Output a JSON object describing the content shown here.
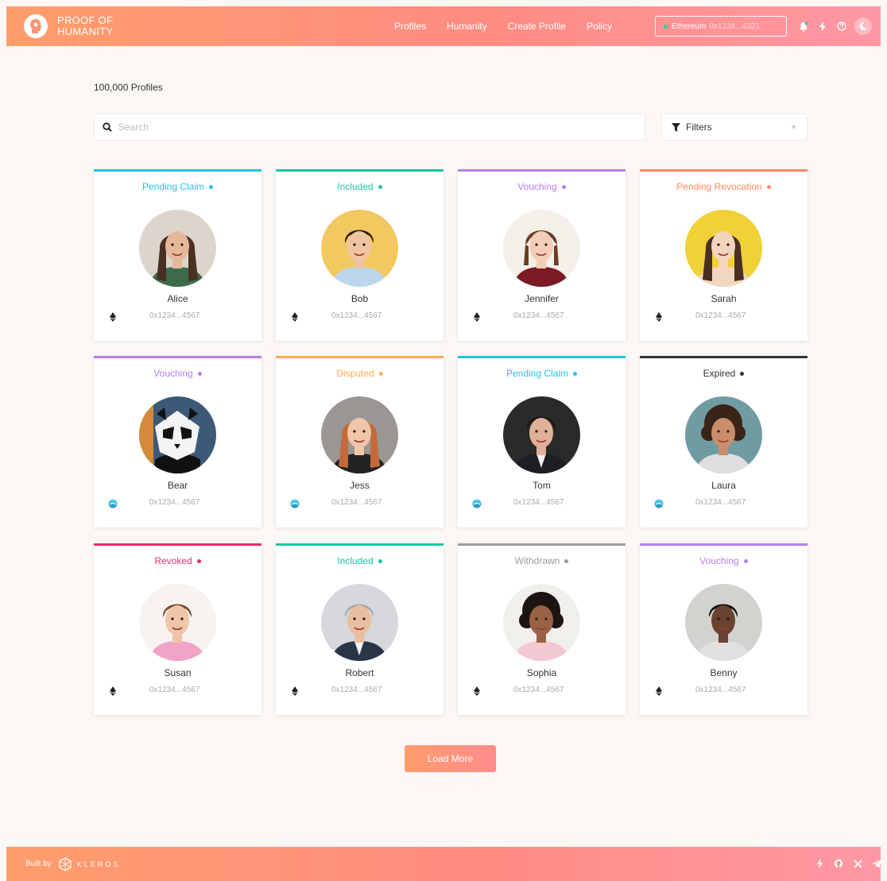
{
  "header": {
    "brand": {
      "line1": "PROOF OF",
      "line2": "HUMANITY"
    },
    "nav": [
      "Profiles",
      "Humanity",
      "Create Profile",
      "Policy"
    ],
    "wallet": {
      "network": "Ethereum",
      "address": "0x1234...4321"
    },
    "icons": [
      "bell-icon",
      "lightning-icon",
      "help-icon",
      "moon-icon"
    ]
  },
  "summary": {
    "count": "100,000",
    "label": "Profiles"
  },
  "search": {
    "placeholder": "Search"
  },
  "filters": {
    "label": "Filters"
  },
  "colors": {
    "pending_claim": "#22c4e8",
    "included": "#18c7a4",
    "vouching": "#b77ef0",
    "pending_revocation": "#ff8c5c",
    "disputed": "#ffac55",
    "expired": "#333333",
    "revoked": "#e6306d",
    "withdrawn": "#9b9b9b"
  },
  "profiles": [
    {
      "status": "Pending Claim",
      "status_key": "pending_claim",
      "name": "Alice",
      "chain": "ethereum",
      "address": "0x1234...4567"
    },
    {
      "status": "Included",
      "status_key": "included",
      "name": "Bob",
      "chain": "ethereum",
      "address": "0x1234...4567"
    },
    {
      "status": "Vouching",
      "status_key": "vouching",
      "name": "Jennifer",
      "chain": "ethereum",
      "address": "0x1234...4567"
    },
    {
      "status": "Pending Revocation",
      "status_key": "pending_revocation",
      "name": "Sarah",
      "chain": "ethereum",
      "address": "0x1234...4567"
    },
    {
      "status": "Vouching",
      "status_key": "vouching",
      "name": "Bear",
      "chain": "gnosis",
      "address": "0x1234...4567"
    },
    {
      "status": "Disputed",
      "status_key": "disputed",
      "name": "Jess",
      "chain": "gnosis",
      "address": "0x1234...4567"
    },
    {
      "status": "Pending Claim",
      "status_key": "pending_claim",
      "name": "Tom",
      "chain": "gnosis",
      "address": "0x1234...4567"
    },
    {
      "status": "Expired",
      "status_key": "expired",
      "name": "Laura",
      "chain": "gnosis",
      "address": "0x1234...4567"
    },
    {
      "status": "Revoked",
      "status_key": "revoked",
      "name": "Susan",
      "chain": "ethereum",
      "address": "0x1234...4567"
    },
    {
      "status": "Included",
      "status_key": "included",
      "name": "Robert",
      "chain": "ethereum",
      "address": "0x1234...4567"
    },
    {
      "status": "Withdrawn",
      "status_key": "withdrawn",
      "name": "Sophia",
      "chain": "ethereum",
      "address": "0x1234...4567"
    },
    {
      "status": "Vouching",
      "status_key": "vouching",
      "name": "Benny",
      "chain": "ethereum",
      "address": "0x1234...4567"
    }
  ],
  "load_more": "Load More",
  "footer": {
    "built_by": "Built by",
    "brand": "KLEROS",
    "icons": [
      "lightning-icon",
      "github-icon",
      "x-icon",
      "telegram-icon"
    ]
  }
}
